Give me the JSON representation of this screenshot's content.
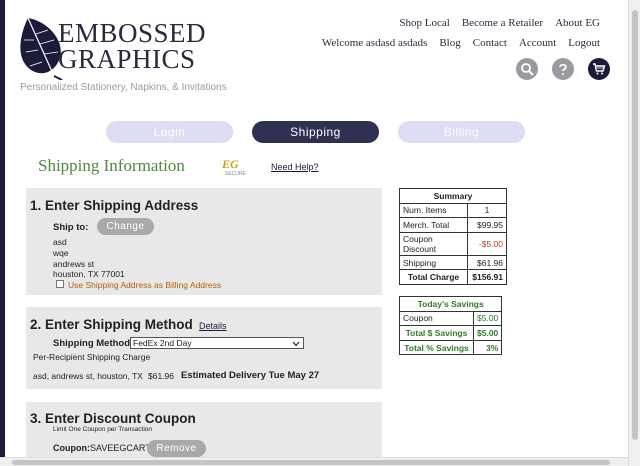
{
  "brand": {
    "line1": "EMBOSSED",
    "line2": "GRAPHICS",
    "tagline": "Personalized Stationery, Napkins, & Invitations"
  },
  "topnav": [
    "Shop Local",
    "Become a Retailer",
    "About EG"
  ],
  "subnav": {
    "welcome": "Welcome asdasd asdads",
    "blog": "Blog",
    "contact": "Contact",
    "account": "Account",
    "logout": "Logout"
  },
  "icons": [
    "search-icon",
    "help-icon",
    "cart-icon"
  ],
  "steps": {
    "login": "Login",
    "shipping": "Shipping",
    "billing": "Billing"
  },
  "page": {
    "title": "Shipping Information",
    "secure_logo": "EG",
    "secure_text": "SECURE",
    "need_help": "Need Help?"
  },
  "shipping_address": {
    "heading": "1. Enter Shipping Address",
    "ship_to_label": "Ship to:",
    "change_button": "Change",
    "lines": [
      "asd",
      "wqe",
      "andrews st",
      "houston, TX 77001"
    ],
    "use_as_billing": "Use Shipping Address as Billing Address"
  },
  "shipping_method": {
    "heading": "2. Enter Shipping Method",
    "details_link": "Details",
    "method_label": "Shipping Method:",
    "selected": "FedEx 2nd Day",
    "note": "Per-Recipient Shipping Charge",
    "recipient": "asd, andrews st, houston, TX",
    "cost": "$61.96",
    "delivery": "Estimated Delivery Tue May 27"
  },
  "discount": {
    "heading": "3. Enter Discount Coupon",
    "limit": "Limit One Coupon per Transaction",
    "coupon_label": "Coupon:",
    "coupon_code": "SAVEEGCART",
    "remove_button": "Remove"
  },
  "summary": {
    "title": "Summary",
    "rows": [
      {
        "label": "Num. Items",
        "value": "1"
      },
      {
        "label": "Merch. Total",
        "value": "$99.95"
      },
      {
        "label": "Coupon Discount",
        "value": "-$5.00"
      },
      {
        "label": "Shipping",
        "value": "$61.96"
      }
    ],
    "total_label": "Total Charge",
    "total_value": "$156.91"
  },
  "savings": {
    "title": "Today's Savings",
    "coupon_label": "Coupon",
    "coupon_value": "$5.00",
    "total_label": "Total $ Savings",
    "total_value": "$5.00",
    "pct_label": "Total % Savings",
    "pct_value": "3%"
  },
  "colors": {
    "brand_dark": "#1c1c3a",
    "heading_green": "#4f8a3e",
    "savings_green": "#2f7a2a",
    "discount_red": "#c0392b",
    "step_inactive": "#dcdcf5",
    "step_active": "#2e3152"
  }
}
